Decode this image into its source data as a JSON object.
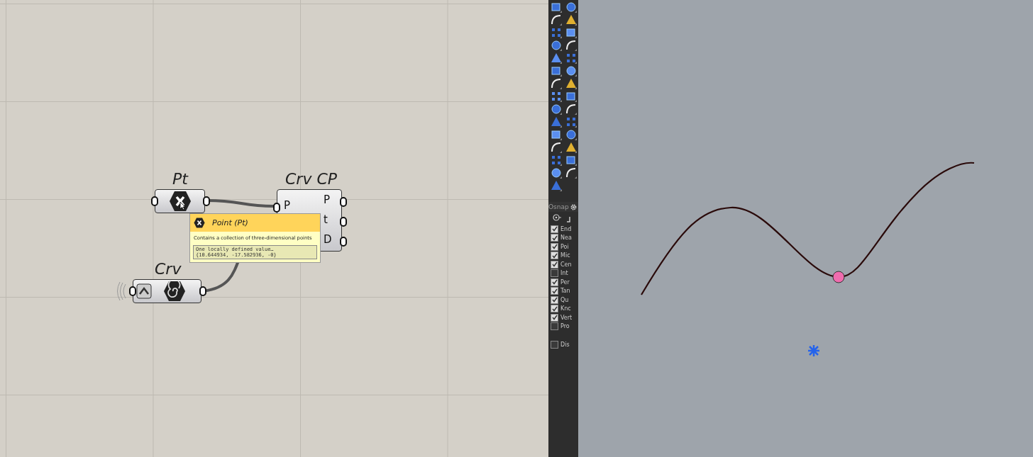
{
  "canvas": {
    "nodes": [
      {
        "kind": "param",
        "title": "Pt"
      },
      {
        "kind": "component",
        "title": "Crv CP",
        "inputs": [
          "P"
        ],
        "outputs": [
          "P",
          "t",
          "D"
        ]
      },
      {
        "kind": "param",
        "title": "Crv"
      }
    ],
    "tooltip": {
      "title": "Point (Pt)",
      "description": "Contains a collection of three-dimensional points",
      "value_lines": [
        "One locally defined value…",
        "{10.644934, -17.582936, -0}"
      ]
    }
  },
  "osnap": {
    "title": "Osnap",
    "items": [
      {
        "label": "End",
        "checked": true
      },
      {
        "label": "Nea",
        "checked": true
      },
      {
        "label": "Poi",
        "checked": true
      },
      {
        "label": "Mic",
        "checked": true
      },
      {
        "label": "Cen",
        "checked": true
      },
      {
        "label": "Int",
        "checked": false
      },
      {
        "label": "Per",
        "checked": true
      },
      {
        "label": "Tan",
        "checked": true
      },
      {
        "label": "Qu",
        "checked": true
      },
      {
        "label": "Knc",
        "checked": true
      },
      {
        "label": "Vert",
        "checked": true
      },
      {
        "label": "Pro",
        "checked": false
      },
      {
        "label": "Dis",
        "checked": false
      }
    ]
  }
}
